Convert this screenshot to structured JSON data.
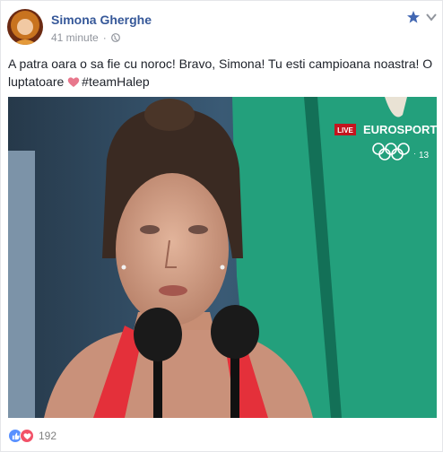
{
  "post": {
    "author": "Simona Gherghe",
    "time": "41 minute",
    "separator": "·",
    "text_main": "A patra oara o sa fie cu noroc! Bravo, Simona! Tu esti campioana noastra! O luptatoare",
    "hashtag": "#teamHalep",
    "reaction_count": "192"
  },
  "photo": {
    "live_badge": "LIVE",
    "channel": "EUROSPORT",
    "channel_num": "13"
  },
  "icons": {
    "globe": "globe-icon",
    "star": "star-icon",
    "chevron": "chevron-down-icon",
    "like": "like-icon",
    "love": "love-icon"
  },
  "colors": {
    "link": "#365899",
    "meta": "#90949c",
    "like": "#5890ff",
    "love": "#f25268"
  }
}
